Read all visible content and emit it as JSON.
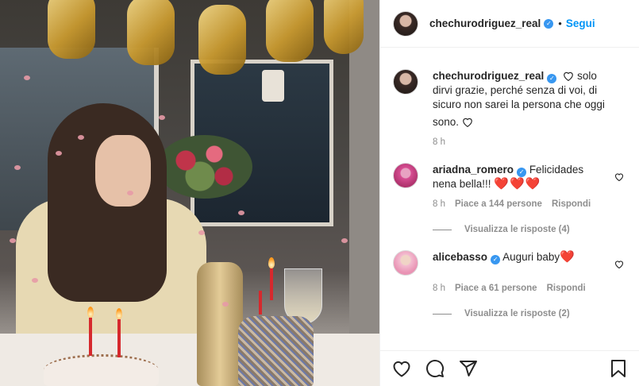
{
  "post": {
    "username": "chechurodriguez_real",
    "follow_label": "Segui",
    "caption_text": "solo dirvi grazie, perché senza di voi, di sicuro non sarei la persona che oggi sono.",
    "caption_time": "8 h"
  },
  "comments": [
    {
      "username": "ariadna_romero",
      "text": "Felicidades nena bella!!!",
      "hearts": "❤️❤️❤️",
      "time": "8 h",
      "likes": "Piace a 144 persone",
      "reply": "Rispondi",
      "view_replies": "Visualizza le risposte (4)"
    },
    {
      "username": "alicebasso",
      "text": "Auguri baby",
      "hearts": "❤️",
      "time": "8 h",
      "likes": "Piace a 61 persone",
      "reply": "Rispondi",
      "view_replies": "Visualizza le risposte (2)"
    }
  ],
  "icons": {
    "like": "heart-icon",
    "comment": "comment-icon",
    "share": "share-icon",
    "save": "bookmark-icon",
    "verified": "verified-badge-icon"
  },
  "colors": {
    "accent": "#0095f6",
    "verified": "#3897f0",
    "heart": "#ed4956",
    "muted": "#8e8e8e"
  }
}
